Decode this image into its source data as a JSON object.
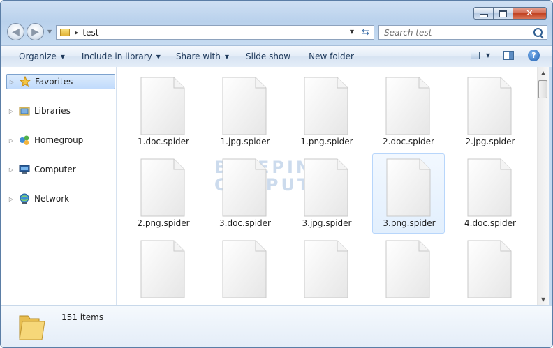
{
  "window": {
    "address": {
      "crumb": "test"
    },
    "search": {
      "placeholder": "Search test"
    }
  },
  "toolbar": {
    "organize": "Organize",
    "include_in_library": "Include in library",
    "share_with": "Share with",
    "slide_show": "Slide show",
    "new_folder": "New folder"
  },
  "nav_pane": {
    "items": [
      {
        "label": "Favorites",
        "icon": "star-icon"
      },
      {
        "label": "Libraries",
        "icon": "libraries-icon"
      },
      {
        "label": "Homegroup",
        "icon": "homegroup-icon"
      },
      {
        "label": "Computer",
        "icon": "computer-icon"
      },
      {
        "label": "Network",
        "icon": "network-icon"
      }
    ]
  },
  "files": [
    {
      "name": "1.doc.spider"
    },
    {
      "name": "1.jpg.spider"
    },
    {
      "name": "1.png.spider"
    },
    {
      "name": "2.doc.spider"
    },
    {
      "name": "2.jpg.spider"
    },
    {
      "name": "2.png.spider"
    },
    {
      "name": "3.doc.spider"
    },
    {
      "name": "3.jpg.spider"
    },
    {
      "name": "3.png.spider"
    },
    {
      "name": "4.doc.spider"
    },
    {
      "name": ""
    },
    {
      "name": ""
    },
    {
      "name": ""
    },
    {
      "name": ""
    },
    {
      "name": ""
    }
  ],
  "selected_file": "3.png.spider",
  "watermark": {
    "line1": "BLEEPING",
    "line2": "COMPUTER"
  },
  "details": {
    "item_count": "151 items"
  },
  "colors": {
    "window_frame": "#b9d1ec",
    "selection": "#c1dbfc",
    "watermark": "#8fb0d8"
  }
}
